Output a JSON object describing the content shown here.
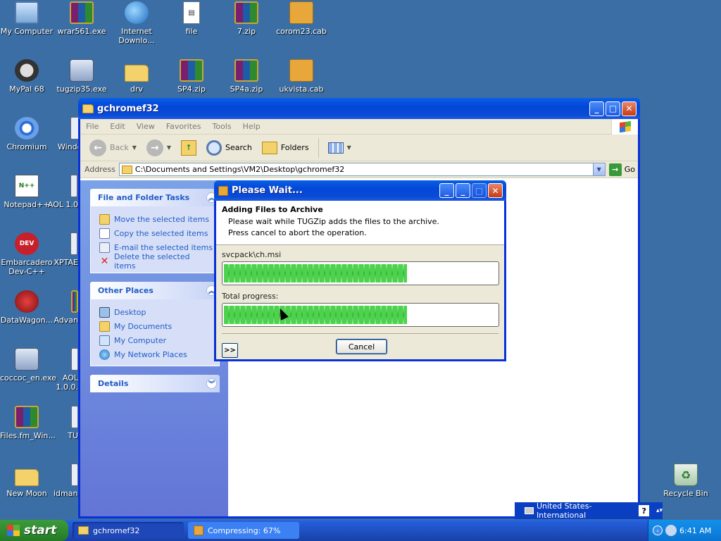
{
  "desktop": {
    "icons": [
      {
        "label": "My Computer",
        "icon": "my-computer-icon"
      },
      {
        "label": "wrar561.exe",
        "icon": "winrar-icon"
      },
      {
        "label": "Internet Downlo...",
        "icon": "internet-download-manager-icon"
      },
      {
        "label": "file",
        "icon": "file-icon"
      },
      {
        "label": "7.zip",
        "icon": "zip-archive-icon"
      },
      {
        "label": "corom23.cab",
        "icon": "cab-archive-icon"
      },
      {
        "label": "MyPal 68",
        "icon": "mypal-browser-icon"
      },
      {
        "label": "tugzip35.exe",
        "icon": "installer-icon"
      },
      {
        "label": "drv",
        "icon": "folder-icon"
      },
      {
        "label": "SP4.zip",
        "icon": "zip-archive-icon"
      },
      {
        "label": "SP4a.zip",
        "icon": "zip-archive-icon"
      },
      {
        "label": "ukvista.cab",
        "icon": "cab-archive-icon"
      },
      {
        "label": "Chromium",
        "icon": "chromium-icon"
      },
      {
        "label": "Windo",
        "icon": "application-icon"
      },
      {
        "label": "Notepad++",
        "icon": "notepad-plus-plus-icon"
      },
      {
        "label": "AOL 1.0",
        "icon": "application-icon"
      },
      {
        "label": "Embarcadero Dev-C++",
        "icon": "dev-cpp-icon"
      },
      {
        "label": "XPTAE",
        "icon": "application-icon"
      },
      {
        "label": "DataWagon...",
        "icon": "datawagon-icon"
      },
      {
        "label": "Advan",
        "icon": "winrar-icon"
      },
      {
        "label": "coccoc_en.exe",
        "icon": "installer-icon"
      },
      {
        "label": "AOL 1.0.0.",
        "icon": "application-icon"
      },
      {
        "label": "Files.fm_Win...",
        "icon": "winrar-icon"
      },
      {
        "label": "TU",
        "icon": "application-icon"
      },
      {
        "label": "New Moon",
        "icon": "folder-icon"
      },
      {
        "label": "idmane",
        "icon": "application-icon"
      },
      {
        "label": "Recycle Bin",
        "icon": "recycle-bin-icon"
      }
    ]
  },
  "explorer": {
    "title": "gchromef32",
    "menu": [
      "File",
      "Edit",
      "View",
      "Favorites",
      "Tools",
      "Help"
    ],
    "toolbar": {
      "back_label": "Back",
      "search_label": "Search",
      "folders_label": "Folders"
    },
    "address": {
      "label": "Address",
      "value": "C:\\Documents and Settings\\VM2\\Desktop\\gchromef32",
      "go_label": "Go"
    },
    "tasks_panel": {
      "title": "File and Folder Tasks",
      "items": [
        "Move the selected items",
        "Copy the selected items",
        "E-mail the selected items",
        "Delete the selected items"
      ]
    },
    "places_panel": {
      "title": "Other Places",
      "items": [
        "Desktop",
        "My Documents",
        "My Computer",
        "My Network Places"
      ]
    },
    "details_panel": {
      "title": "Details"
    }
  },
  "dialog": {
    "title": "Please Wait...",
    "heading": "Adding Files to Archive",
    "line1": "Please wait while TUGZip adds the files to the archive.",
    "line2": "Press cancel to abort the operation.",
    "current_file": "svcpack\\ch.msi",
    "file_progress": 0.67,
    "total_label": "Total progress:",
    "total_progress": 0.67,
    "more_label": ">>",
    "cancel_label": "Cancel"
  },
  "langbar": {
    "language": "United States-International",
    "help": "?"
  },
  "taskbar": {
    "start_label": "start",
    "tasks": [
      {
        "label": "gchromef32",
        "active": true
      },
      {
        "label": "Compressing: 67%",
        "active": false
      }
    ],
    "clock": "6:41 AM"
  },
  "colors": {
    "desktop": "#3a6ea5",
    "xp_blue": "#0a4bd6",
    "progress_green": "#3bc43b",
    "start_green": "#2f8c2f"
  }
}
